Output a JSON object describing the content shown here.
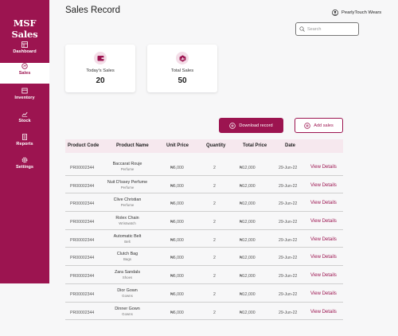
{
  "app": {
    "brand": "MSF Sales"
  },
  "sidebar": {
    "items": [
      {
        "label": "Dashboard",
        "icon": "dashboard-icon",
        "active": false
      },
      {
        "label": "Sales",
        "icon": "sales-icon",
        "active": true
      },
      {
        "label": "Inventory",
        "icon": "inventory-icon",
        "active": false
      },
      {
        "label": "Stock",
        "icon": "stock-icon",
        "active": false
      },
      {
        "label": "Reports",
        "icon": "reports-icon",
        "active": false
      },
      {
        "label": "Settings",
        "icon": "settings-icon",
        "active": false
      }
    ]
  },
  "header": {
    "title": "Sales Record",
    "user_name": "PearlyTouch Wears",
    "search_placeholder": "Search"
  },
  "cards": {
    "today": {
      "label": "Today's Sales",
      "value": "20"
    },
    "total": {
      "label": "Total Sales",
      "value": "50"
    }
  },
  "actions": {
    "download": "Download record",
    "add": "Add sales"
  },
  "table": {
    "headers": [
      "Product Code",
      "Product Name",
      "Unit Price",
      "Quantity",
      "Total Price",
      "Date"
    ],
    "view_label": "View Details",
    "rows": [
      {
        "code": "PR00002344",
        "name": "Baccarat Rouje",
        "category": "Perfume",
        "price": "₦6,000",
        "qty": "2",
        "total": "₦12,000",
        "date": "29-Jun-22"
      },
      {
        "code": "PR00002344",
        "name": "Nuit D'issey Perfume",
        "category": "Perfume",
        "price": "₦6,000",
        "qty": "2",
        "total": "₦12,000",
        "date": "29-Jun-22"
      },
      {
        "code": "PR00002344",
        "name": "Clive Christian",
        "category": "Perfume",
        "price": "₦6,000",
        "qty": "2",
        "total": "₦12,000",
        "date": "29-Jun-22"
      },
      {
        "code": "PR00002344",
        "name": "Rolex Chain",
        "category": "Wristwatch",
        "price": "₦6,000",
        "qty": "2",
        "total": "₦12,000",
        "date": "29-Jun-22"
      },
      {
        "code": "PR00002344",
        "name": "Automatic Belt",
        "category": "Belt",
        "price": "₦6,000",
        "qty": "2",
        "total": "₦12,000",
        "date": "29-Jun-22"
      },
      {
        "code": "PR00002344",
        "name": "Clutch Bag",
        "category": "Bags",
        "price": "₦6,000",
        "qty": "2",
        "total": "₦12,000",
        "date": "29-Jun-22"
      },
      {
        "code": "PR00002344",
        "name": "Zara Sandals",
        "category": "Shoes",
        "price": "₦6,000",
        "qty": "2",
        "total": "₦12,000",
        "date": "29-Jun-22"
      },
      {
        "code": "PR00002344",
        "name": "Dior Gown",
        "category": "Gowns",
        "price": "₦6,000",
        "qty": "2",
        "total": "₦12,000",
        "date": "29-Jun-22"
      },
      {
        "code": "PR00002344",
        "name": "Dinner Gown",
        "category": "Gowns",
        "price": "₦6,000",
        "qty": "2",
        "total": "₦12,000",
        "date": "29-Jun-22"
      }
    ]
  },
  "colors": {
    "brand": "#9c1450",
    "header_row": "#f6e8ee",
    "active_bg": "#ffffff"
  }
}
